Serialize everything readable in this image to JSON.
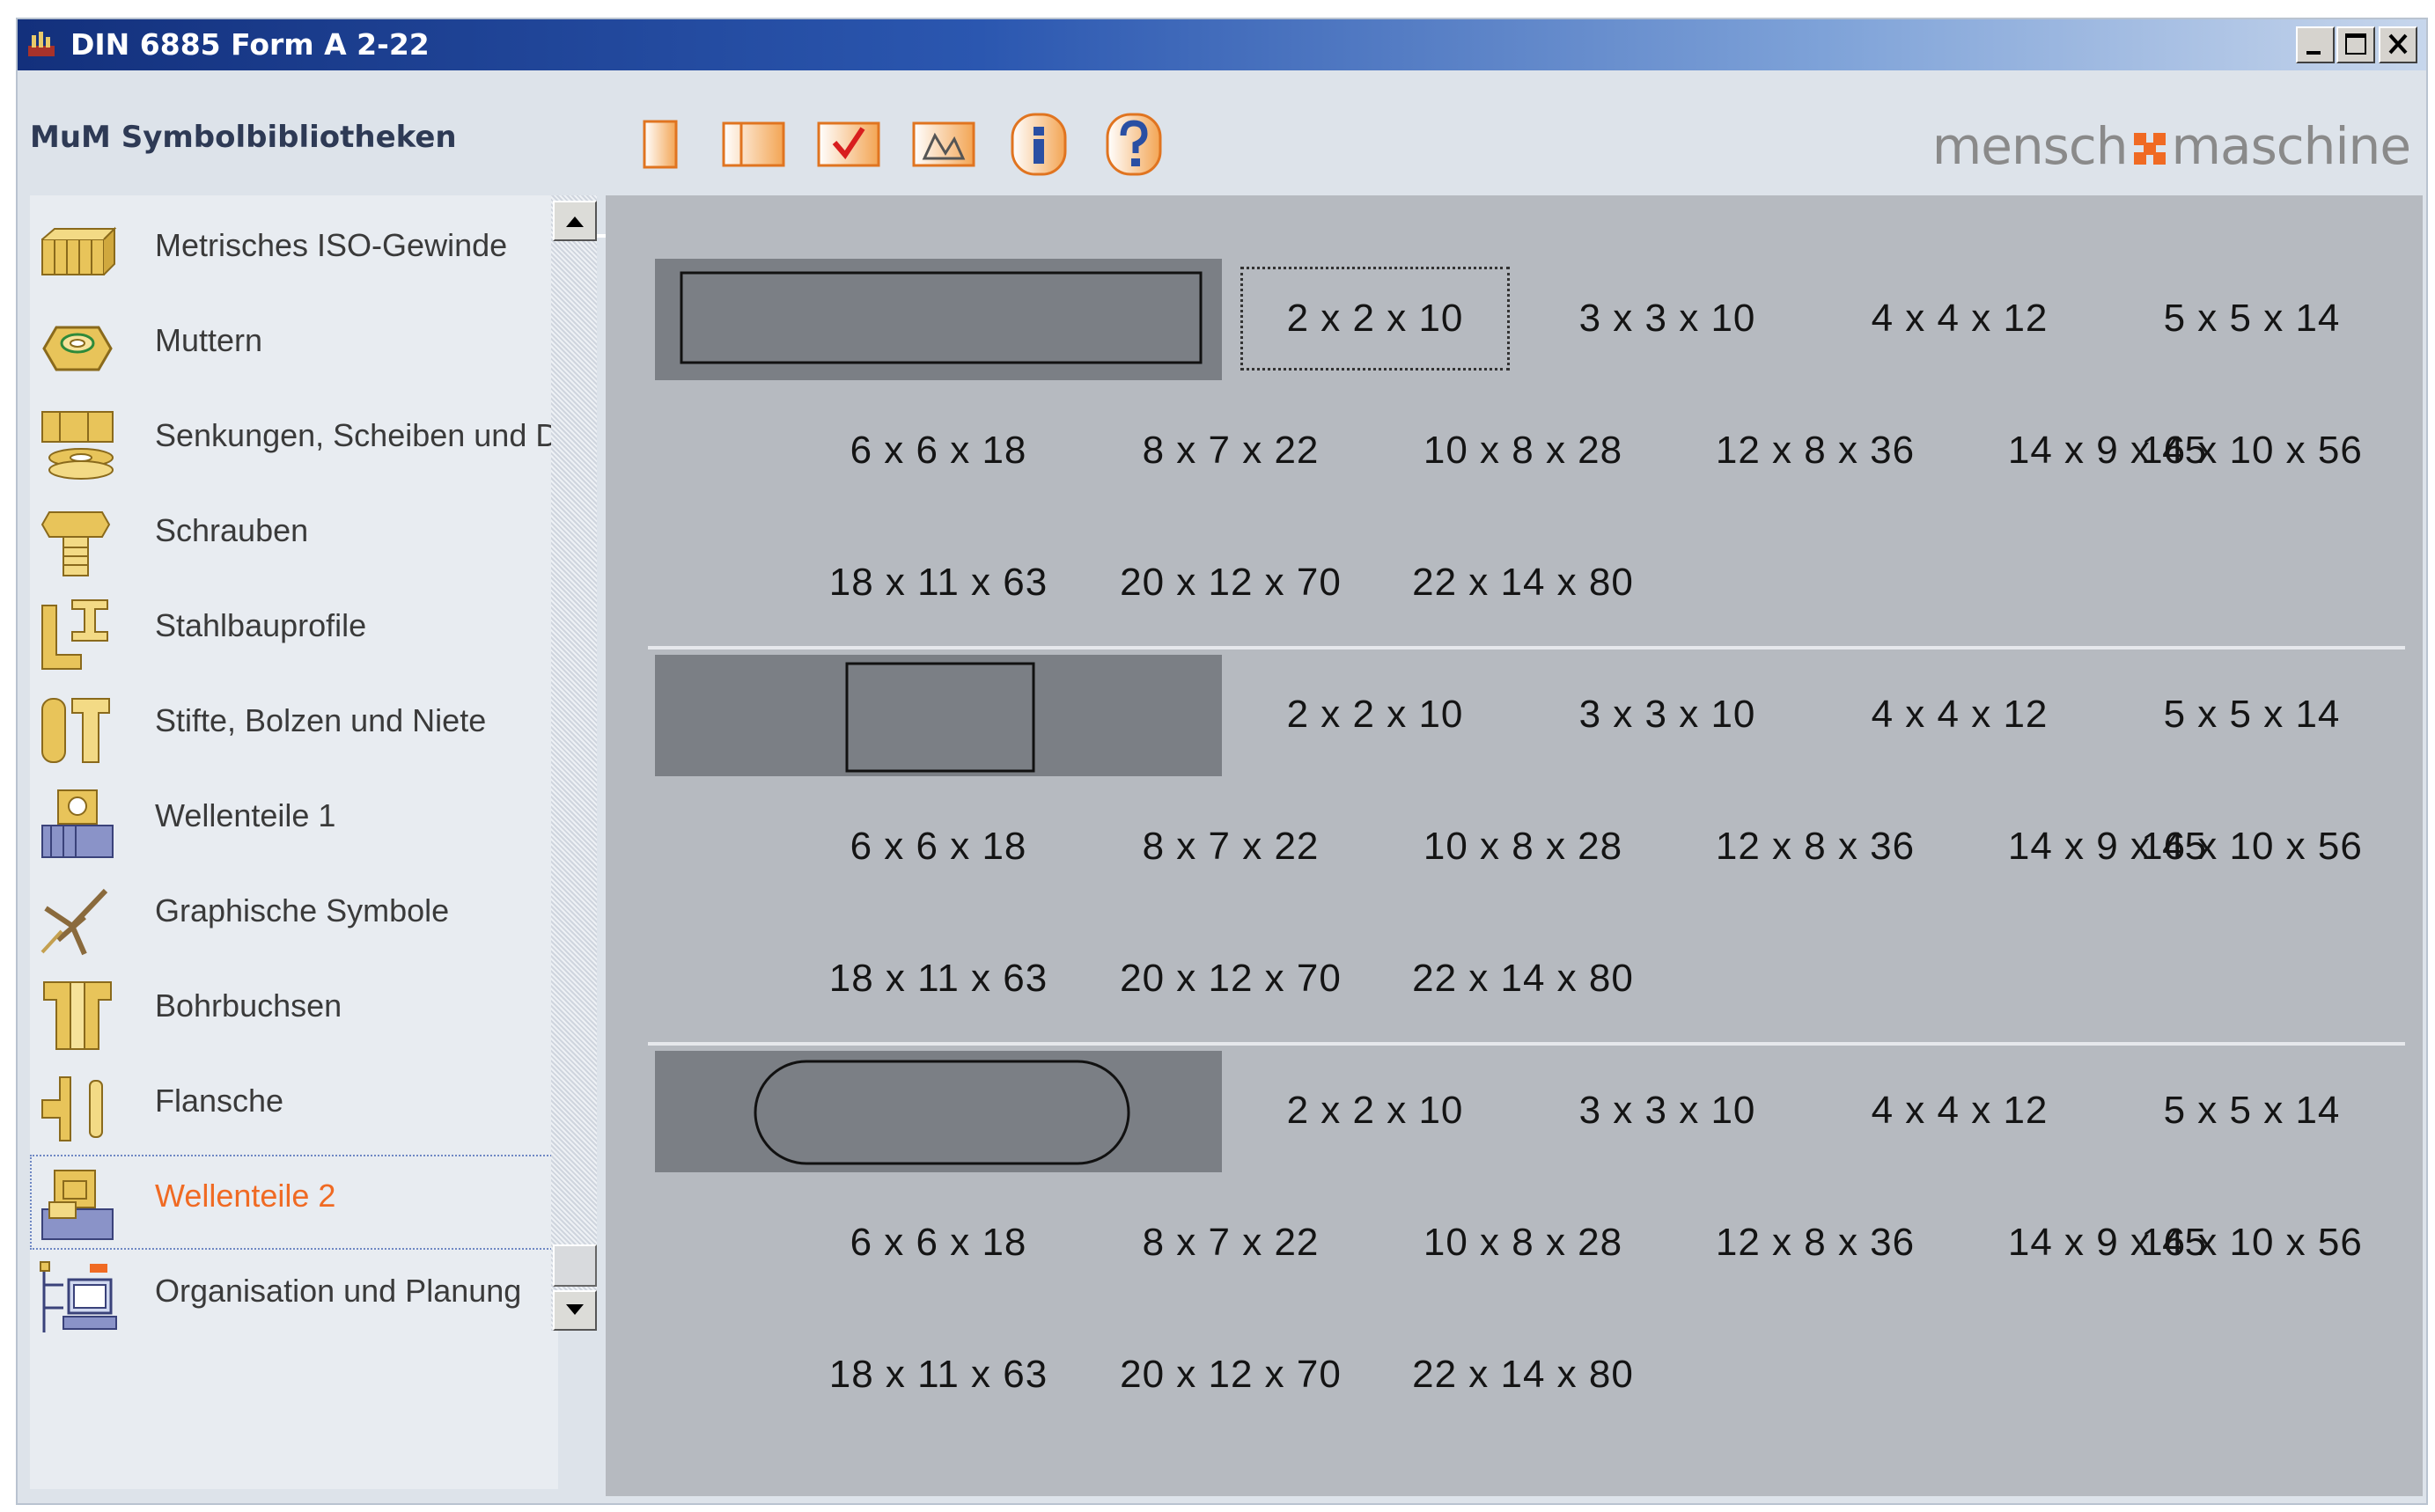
{
  "window": {
    "title": "DIN 6885 Form A 2-22",
    "controls": [
      "minimize",
      "maximize",
      "close"
    ]
  },
  "header": {
    "app_label": "MuM Symbolbibliotheken",
    "toolbar_icons": [
      "new-icon",
      "panel-icon",
      "check-icon",
      "edit-icon",
      "info-icon",
      "help-icon"
    ],
    "logo_left": "mensch",
    "logo_right": "maschine",
    "logo_mark_color": "#f06a23"
  },
  "sidebar": {
    "items": [
      {
        "label": "Metrisches ISO-Gewinde",
        "icon": "thread-icon"
      },
      {
        "label": "Muttern",
        "icon": "nut-icon"
      },
      {
        "label": "Senkungen, Scheiben und Du",
        "icon": "washer-icon"
      },
      {
        "label": "Schrauben",
        "icon": "screw-icon"
      },
      {
        "label": "Stahlbauprofile",
        "icon": "steel-profile-icon"
      },
      {
        "label": "Stifte, Bolzen und Niete",
        "icon": "pin-bolt-icon"
      },
      {
        "label": "Wellenteile 1",
        "icon": "shaft-part-icon"
      },
      {
        "label": "Graphische Symbole",
        "icon": "graphic-symbol-icon"
      },
      {
        "label": "Bohrbuchsen",
        "icon": "drill-bush-icon"
      },
      {
        "label": "Flansche",
        "icon": "flange-icon"
      },
      {
        "label": "Wellenteile 2",
        "icon": "shaft-part-2-icon",
        "selected": true
      },
      {
        "label": "Organisation und Planung",
        "icon": "organisation-icon"
      }
    ],
    "selected_color": "#f06a23"
  },
  "content": {
    "sections": [
      {
        "shape": "rectangle-wide",
        "sizes": [
          "2 x 2 x 10",
          "3 x 3 x 10",
          "4 x 4 x 12",
          "5 x 5 x 14",
          "6 x 6 x 18",
          "8 x 7 x 22",
          "10 x 8 x 28",
          "12 x 8 x 36",
          "14 x 9 x 45",
          "16 x 10 x 56",
          "18 x 11 x 63",
          "20 x 12 x 70",
          "22 x 14 x 80"
        ],
        "focused_index": 0
      },
      {
        "shape": "rectangle-narrow",
        "sizes": [
          "2 x 2 x 10",
          "3 x 3 x 10",
          "4 x 4 x 12",
          "5 x 5 x 14",
          "6 x 6 x 18",
          "8 x 7 x 22",
          "10 x 8 x 28",
          "12 x 8 x 36",
          "14 x 9 x 45",
          "16 x 10 x 56",
          "18 x 11 x 63",
          "20 x 12 x 70",
          "22 x 14 x 80"
        ]
      },
      {
        "shape": "rounded-slot",
        "sizes": [
          "2 x 2 x 10",
          "3 x 3 x 10",
          "4 x 4 x 12",
          "5 x 5 x 14",
          "6 x 6 x 18",
          "8 x 7 x 22",
          "10 x 8 x 28",
          "12 x 8 x 36",
          "14 x 9 x 45",
          "16 x 10 x 56",
          "18 x 11 x 63",
          "20 x 12 x 70",
          "22 x 14 x 80"
        ]
      }
    ]
  }
}
